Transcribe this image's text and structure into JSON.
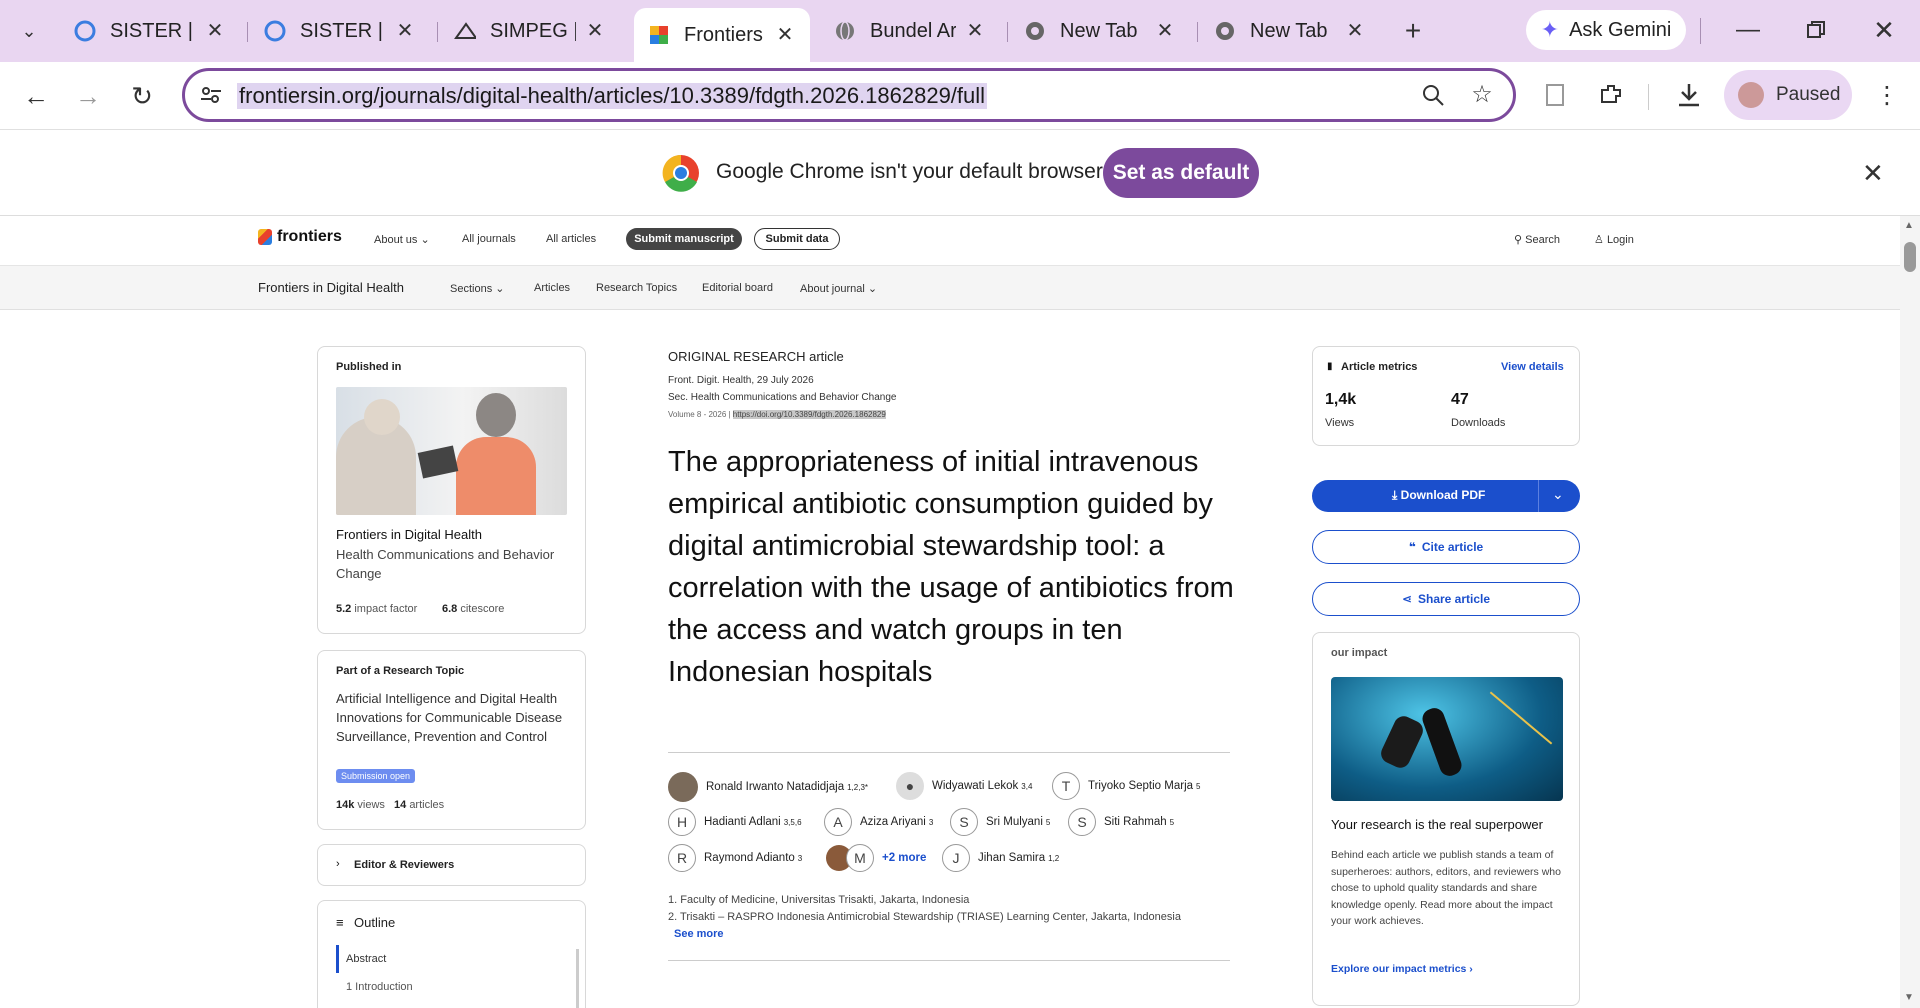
{
  "browser": {
    "tabs": [
      {
        "title": "SISTER | La",
        "icon": "sister-icon"
      },
      {
        "title": "SISTER | Tr",
        "icon": "sister-icon"
      },
      {
        "title": "SIMPEG | U",
        "icon": "simpeg-icon"
      },
      {
        "title": "Frontiers |",
        "icon": "frontiers-icon"
      },
      {
        "title": "Bundel Art",
        "icon": "globe-icon"
      },
      {
        "title": "New Tab",
        "icon": "chrome-icon"
      },
      {
        "title": "New Tab",
        "icon": "chrome-icon"
      }
    ],
    "gemini_label": "Ask Gemini",
    "url": "frontiersin.org/journals/digital-health/articles/10.3389/fdgth.2026.1862829/full",
    "profile_label": "Paused",
    "infobar": {
      "message": "Google Chrome isn't your default browser",
      "button": "Set as default"
    }
  },
  "site": {
    "logo": "frontiers",
    "nav": {
      "about": "About us",
      "journals": "All journals",
      "articles": "All articles",
      "submit": "Submit manuscript",
      "data": "Submit data",
      "search": "Search",
      "login": "Login"
    },
    "subnav": {
      "journal": "Frontiers in Digital Health",
      "sections": "Sections",
      "articles": "Articles",
      "topics": "Research Topics",
      "board": "Editorial board",
      "about": "About journal"
    }
  },
  "left": {
    "published": {
      "heading": "Published in",
      "journal": "Frontiers in Digital Health",
      "section": "Health Communications and Behavior Change",
      "impact_value": "5.2",
      "impact_label": "impact factor",
      "cite_value": "6.8",
      "cite_label": "citescore"
    },
    "topic": {
      "heading": "Part of a Research Topic",
      "title": "Artificial Intelligence and Digital Health Innovations for Communicable Disease Surveillance, Prevention and Control",
      "badge": "Submission open",
      "views_value": "14k",
      "views_label": "views",
      "articles_value": "14",
      "articles_label": "articles"
    },
    "editors": "Editor & Reviewers",
    "outline": {
      "heading": "Outline",
      "items": [
        "Abstract",
        "1 Introduction"
      ]
    }
  },
  "article": {
    "type": "ORIGINAL RESEARCH article",
    "journal_line": "Front. Digit. Health, 29 July 2026",
    "section_line": "Sec. Health Communications and Behavior Change",
    "volume": "Volume 8 - 2026 |",
    "doi": "https://doi.org/10.3389/fdgth.2026.1862829",
    "title": "The appropriateness of initial intravenous empirical antibiotic consumption guided by digital antimicrobial stewardship tool: a correlation with the usage of antibiotics from the access and watch groups in ten Indonesian hospitals",
    "authors": [
      {
        "name": "Ronald Irwanto Natadidjaja",
        "sup": "1,2,3*",
        "initial": ""
      },
      {
        "name": "Widyawati Lekok",
        "sup": "3,4",
        "initial": ""
      },
      {
        "name": "Triyoko Septio Marja",
        "sup": "5",
        "initial": "T"
      },
      {
        "name": "Hadianti Adlani",
        "sup": "3,5,6",
        "initial": "H"
      },
      {
        "name": "Aziza Ariyani",
        "sup": "3",
        "initial": "A"
      },
      {
        "name": "Sri Mulyani",
        "sup": "5",
        "initial": "S"
      },
      {
        "name": "Siti Rahmah",
        "sup": "5",
        "initial": "S"
      },
      {
        "name": "Raymond Adianto",
        "sup": "3",
        "initial": "R"
      },
      {
        "name": "Jihan Samira",
        "sup": "1,2",
        "initial": "J"
      }
    ],
    "more_initial": "M",
    "more_authors": "+2 more",
    "affiliations": [
      "1. Faculty of Medicine, Universitas Trisakti, Jakarta, Indonesia",
      "2. Trisakti – RASPRO Indonesia Antimicrobial Stewardship (TRIASE) Learning Center, Jakarta, Indonesia"
    ],
    "see_more": "See more"
  },
  "right": {
    "metrics": {
      "heading": "Article metrics",
      "details": "View details",
      "views_value": "1,4k",
      "views_label": "Views",
      "downloads_value": "47",
      "downloads_label": "Downloads"
    },
    "download": "Download PDF",
    "cite": "Cite article",
    "share": "Share article",
    "impact": {
      "heading": "our impact",
      "title": "Your research is the real superpower",
      "body": "Behind each article we publish stands a team of superheroes: authors, editors, and reviewers who chose to uphold quality standards and share knowledge openly. Read more about the impact your work achieves.",
      "link": "Explore our impact metrics"
    }
  },
  "colors": {
    "chrome_accent": "#7c4a9c",
    "link_blue": "#1b4fcc",
    "tabstrip": "#e9d6f1"
  }
}
